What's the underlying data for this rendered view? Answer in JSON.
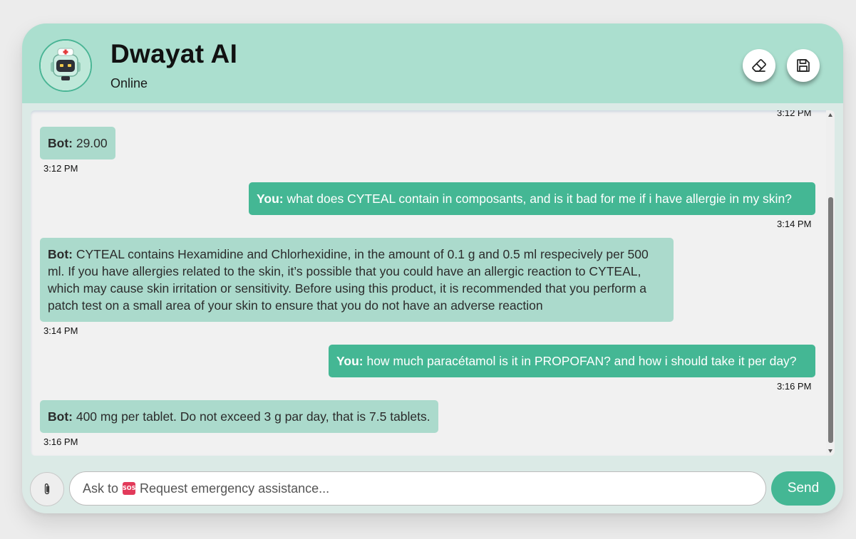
{
  "app": {
    "title": "Dwayat AI",
    "status": "Online"
  },
  "header_buttons": {
    "clear_icon": "eraser-icon",
    "save_icon": "floppy-disk-icon"
  },
  "colors": {
    "header_bg": "#abdfcf",
    "bot_bubble": "#abdacc",
    "user_bubble": "#44b794",
    "send_button": "#44b794"
  },
  "chat": {
    "top_partial_time": "3:12 PM",
    "messages": [
      {
        "sender": "bot",
        "speaker": "Bot:",
        "text": " 29.00",
        "time": "3:12 PM"
      },
      {
        "sender": "user",
        "speaker": "You:",
        "text": " what does CYTEAL contain in composants, and is it bad for me if i have allergie in my skin?",
        "time": "3:14 PM"
      },
      {
        "sender": "bot",
        "speaker": "Bot:",
        "text": " CYTEAL contains Hexamidine and Chlorhexidine, in the amount of 0.1 g and 0.5 ml respecively per 500 ml. If you have allergies related to the skin, it’s possible that you could have an allergic reaction to CYTEAL, which may cause skin irritation or sensitivity. Before using this product, it is recommended that you perform a patch test on a small area of your skin to ensure that you do not have an adverse reaction",
        "time": "3:14 PM"
      },
      {
        "sender": "user",
        "speaker": "You:",
        "text": " how much paracétamol is it in PROPOFAN? and how i should take it per day?",
        "time": "3:16 PM"
      },
      {
        "sender": "bot",
        "speaker": "Bot:",
        "text": " 400 mg per tablet. Do not exceed 3 g par day, that is 7.5 tablets.",
        "time": "3:16 PM"
      }
    ]
  },
  "composer": {
    "attach_icon": "paperclip-icon",
    "placeholder_prefix": "Ask to",
    "sos_badge": "SOS",
    "placeholder_suffix": "Request emergency assistance...",
    "send_label": "Send"
  }
}
